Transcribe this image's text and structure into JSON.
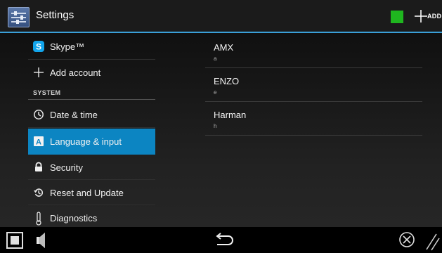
{
  "action_bar": {
    "title": "Settings",
    "app_icon": "settings-sliders-icon",
    "status_color": "#1fb61f",
    "add_label": "ADD"
  },
  "sidebar": {
    "items": [
      {
        "label": "Skype™",
        "icon": "skype-icon"
      },
      {
        "label": "Add account",
        "icon": "plus-icon"
      },
      {
        "label": "Date & time",
        "icon": "clock-icon"
      },
      {
        "label": "Language & input",
        "icon": "keyboard-a-icon",
        "selected": true
      },
      {
        "label": "Security",
        "icon": "lock-icon"
      },
      {
        "label": "Reset and Update",
        "icon": "reset-icon"
      },
      {
        "label": "Diagnostics",
        "icon": "thermometer-icon"
      }
    ],
    "section_header": "SYSTEM"
  },
  "keyboards": [
    {
      "name": "AMX",
      "subtitle": "a"
    },
    {
      "name": "ENZO",
      "subtitle": "e"
    },
    {
      "name": "Harman",
      "subtitle": "h"
    }
  ],
  "nav_bar": {
    "buttons": [
      "square-icon",
      "speaker-icon",
      "back-arrow-icon",
      "close-circle-icon",
      "resize-grip-icon"
    ]
  },
  "colors": {
    "accent": "#3a9fd8",
    "selected": "#0c85c2",
    "skype": "#12a5ec"
  }
}
